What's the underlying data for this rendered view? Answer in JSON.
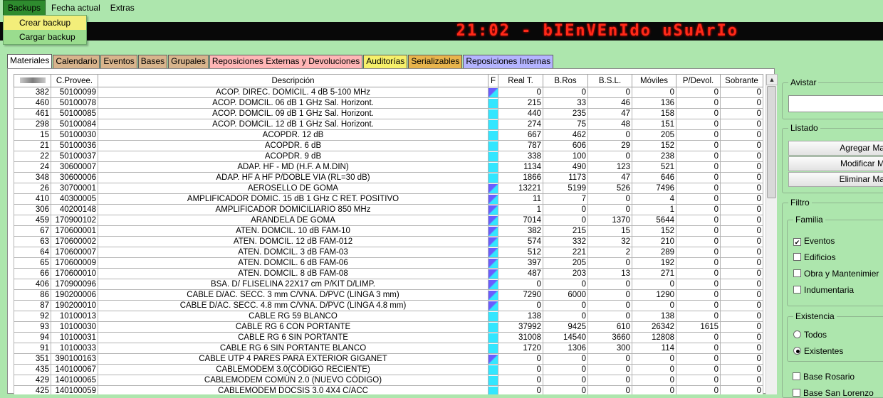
{
  "menu": {
    "items": [
      {
        "label": "Backups",
        "name": "menu-backups",
        "open": true
      },
      {
        "label": "Fecha actual",
        "name": "menu-fecha-actual",
        "open": false
      },
      {
        "label": "Extras",
        "name": "menu-extras",
        "open": false
      }
    ]
  },
  "backups_menu": [
    {
      "label": "Crear backup",
      "highlighted": true
    },
    {
      "label": "Cargar backup",
      "highlighted": false
    }
  ],
  "banner": {
    "text": "21:02 - bIEnVEnIdo uSuArIo",
    "color": "#ff2a18"
  },
  "tabs": [
    {
      "label": "Materiales",
      "color": "#ffffff",
      "active": true
    },
    {
      "label": "Calendario",
      "color": "#d8b48c",
      "active": false
    },
    {
      "label": "Eventos",
      "color": "#d8b48c",
      "active": false
    },
    {
      "label": "Bases",
      "color": "#d8b48c",
      "active": false
    },
    {
      "label": "Grupales",
      "color": "#d8b48c",
      "active": false
    },
    {
      "label": "Reposiciones Externas y Devoluciones",
      "color": "#ffb6b6",
      "active": false
    },
    {
      "label": "Auditorías",
      "color": "#f6f06a",
      "active": false
    },
    {
      "label": "Serializables",
      "color": "#e8b44c",
      "active": false
    },
    {
      "label": "Reposiciones Internas",
      "color": "#b4b4ff",
      "active": false
    }
  ],
  "table": {
    "headers": [
      "",
      "C.Provee.",
      "Descripción",
      "F",
      "Real T.",
      "B.Ros",
      "B.S.L.",
      "Móviles",
      "P/Devol.",
      "Sobrante"
    ],
    "rows": [
      [
        "382",
        "50100099",
        "ACOP. DIREC. DOMICIL. 4 dB 5-100 MHz",
        "g",
        "0",
        "0",
        "0",
        "0",
        "0",
        "0"
      ],
      [
        "460",
        "50100078",
        "ACOP. DOMCIL. 06 dB 1 GHz Sal. Horizont.",
        "c",
        "215",
        "33",
        "46",
        "136",
        "0",
        "0"
      ],
      [
        "461",
        "50100085",
        "ACOP. DOMCIL. 09 dB 1 GHz Sal. Horizont.",
        "c",
        "440",
        "235",
        "47",
        "158",
        "0",
        "0"
      ],
      [
        "298",
        "50100084",
        "ACOP. DOMCIL. 12 dB 1 GHz Sal. Horizont.",
        "c",
        "274",
        "75",
        "48",
        "151",
        "0",
        "0"
      ],
      [
        "15",
        "50100030",
        "ACOPDR. 12 dB",
        "c",
        "667",
        "462",
        "0",
        "205",
        "0",
        "0"
      ],
      [
        "21",
        "50100036",
        "ACOPDR. 6 dB",
        "c",
        "787",
        "606",
        "29",
        "152",
        "0",
        "0"
      ],
      [
        "22",
        "50100037",
        "ACOPDR. 9 dB",
        "c",
        "338",
        "100",
        "0",
        "238",
        "0",
        "0"
      ],
      [
        "24",
        "30600007",
        "ADAP. HF - MD (H.F. A M.DIN)",
        "c",
        "1134",
        "490",
        "123",
        "521",
        "0",
        "0"
      ],
      [
        "348",
        "30600006",
        "ADAP. HF A HF P/DOBLE VIA (RL=30 dB)",
        "c",
        "1866",
        "1173",
        "47",
        "646",
        "0",
        "0"
      ],
      [
        "26",
        "30700001",
        "AEROSELLO DE GOMA",
        "g",
        "13221",
        "5199",
        "526",
        "7496",
        "0",
        "0"
      ],
      [
        "410",
        "40300005",
        "AMPLIFICADOR DOMIC. 15 dB 1 GHz C RET. POSITIVO",
        "g",
        "11",
        "7",
        "0",
        "4",
        "0",
        "0"
      ],
      [
        "306",
        "40200148",
        "AMPLIFICADOR DOMICILIARIO 850 MHz",
        "g",
        "1",
        "0",
        "0",
        "1",
        "0",
        "0"
      ],
      [
        "459",
        "170900102",
        "ARANDELA DE GOMA",
        "g",
        "7014",
        "0",
        "1370",
        "5644",
        "0",
        "0"
      ],
      [
        "67",
        "170600001",
        "ATEN. DOMCIL. 10 dB FAM-10",
        "g",
        "382",
        "215",
        "15",
        "152",
        "0",
        "0"
      ],
      [
        "63",
        "170600002",
        "ATEN. DOMCIL. 12 dB FAM-012",
        "g",
        "574",
        "332",
        "32",
        "210",
        "0",
        "0"
      ],
      [
        "64",
        "170600007",
        "ATEN. DOMCIL. 3 dB FAM-03",
        "g",
        "512",
        "221",
        "2",
        "289",
        "0",
        "0"
      ],
      [
        "65",
        "170600009",
        "ATEN. DOMCIL. 6 dB FAM-06",
        "g",
        "397",
        "205",
        "0",
        "192",
        "0",
        "0"
      ],
      [
        "66",
        "170600010",
        "ATEN. DOMCIL. 8 dB FAM-08",
        "g",
        "487",
        "203",
        "13",
        "271",
        "0",
        "0"
      ],
      [
        "406",
        "170900096",
        "BSA. D/ FLISELINA 22X17 cm P/KIT D/LIMP.",
        "g",
        "0",
        "0",
        "0",
        "0",
        "0",
        "0"
      ],
      [
        "86",
        "190200006",
        "CABLE D/AC. SECC. 3 mm C/VNA. D/PVC (LINGA 3 mm)",
        "g",
        "7290",
        "6000",
        "0",
        "1290",
        "0",
        "0"
      ],
      [
        "87",
        "190200010",
        "CABLE D/AC. SECC. 4.8 mm C/VNA. D/PVC (LINGA 4.8 mm)",
        "g",
        "0",
        "0",
        "0",
        "0",
        "0",
        "0"
      ],
      [
        "92",
        "10100013",
        "CABLE RG 59 BLANCO",
        "c",
        "138",
        "0",
        "0",
        "138",
        "0",
        "0"
      ],
      [
        "93",
        "10100030",
        "CABLE RG 6 CON PORTANTE",
        "c",
        "37992",
        "9425",
        "610",
        "26342",
        "1615",
        "0"
      ],
      [
        "94",
        "10100031",
        "CABLE RG 6 SIN PORTANTE",
        "c",
        "31008",
        "14540",
        "3660",
        "12808",
        "0",
        "0"
      ],
      [
        "91",
        "10100033",
        "CABLE RG 6 SIN PORTANTE BLANCO",
        "c",
        "1720",
        "1306",
        "300",
        "114",
        "0",
        "0"
      ],
      [
        "351",
        "390100163",
        "CABLE UTP 4 PARES PARA EXTERIOR GIGANET",
        "g",
        "0",
        "0",
        "0",
        "0",
        "0",
        "0"
      ],
      [
        "435",
        "140100067",
        "CABLEMODEM 3.0(CÓDIGO RECIENTE)",
        "c",
        "0",
        "0",
        "0",
        "0",
        "0",
        "0"
      ],
      [
        "429",
        "140100065",
        "CABLEMODEM COMÚN 2.0 (NUEVO CÓDIGO)",
        "c",
        "0",
        "0",
        "0",
        "0",
        "0",
        "0"
      ],
      [
        "425",
        "140100059",
        "CABLEMODEM DOCSIS 3.0 4X4 C/ACC",
        "c",
        "0",
        "0",
        "0",
        "0",
        "0",
        "0"
      ]
    ]
  },
  "right_panel": {
    "avistar_label": "Avistar",
    "avistar_value": "",
    "listado_label": "Listado",
    "buttons": [
      "Agregar Ma",
      "Modificar M",
      "Eliminar Ma"
    ],
    "filtro_label": "Filtro",
    "familia_label": "Familia",
    "familia": [
      {
        "label": "Eventos",
        "checked": true
      },
      {
        "label": "Edificios",
        "checked": false
      },
      {
        "label": "Obra y Mantenimier",
        "checked": false
      },
      {
        "label": "Indumentaria",
        "checked": false
      }
    ],
    "existencia_label": "Existencia",
    "existencia": [
      {
        "label": "Todos",
        "selected": false
      },
      {
        "label": "Existentes",
        "selected": true
      }
    ],
    "bases": [
      {
        "label": "Base Rosario",
        "checked": false
      },
      {
        "label": "Base San Lorenzo",
        "checked": false
      }
    ]
  }
}
